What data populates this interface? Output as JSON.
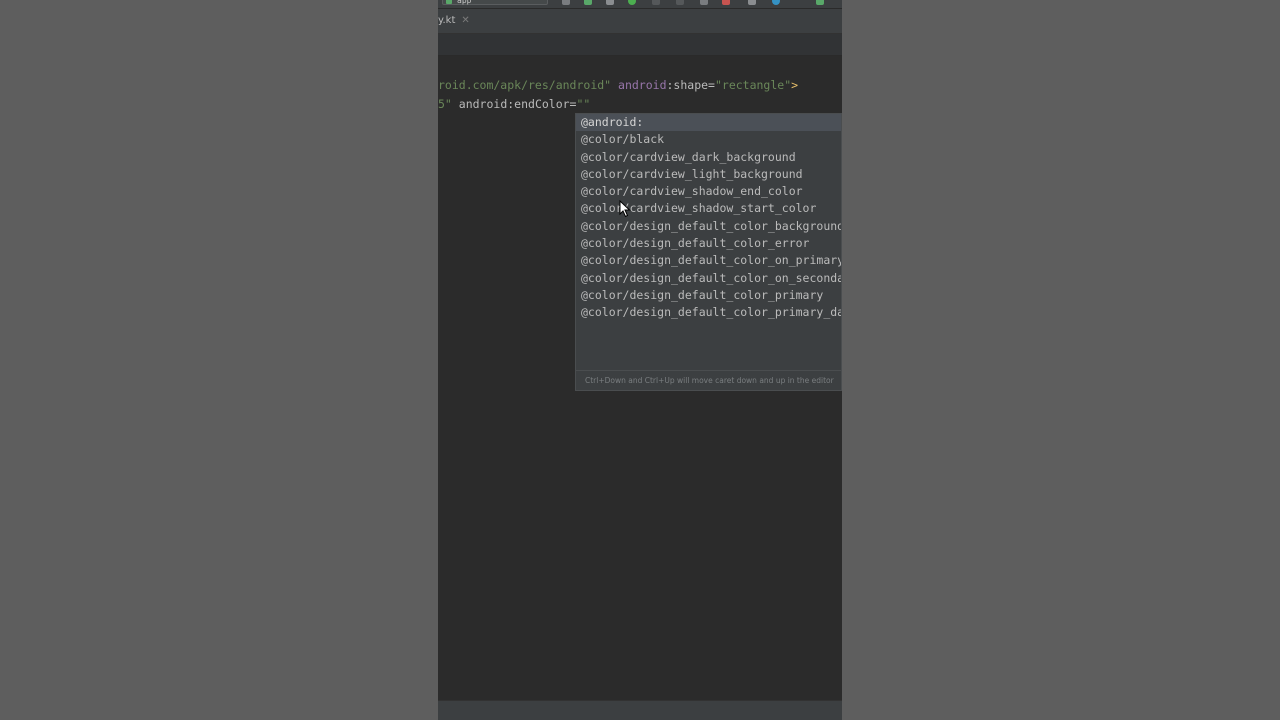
{
  "window": {
    "toolbar_field": "app"
  },
  "tabs": [
    {
      "label": "y.kt"
    }
  ],
  "editor": {
    "line1": {
      "p1": "roid.com/apk/res/android\"",
      "ns": "android",
      "attr": ":shape=",
      "val": "\"rectangle\"",
      "end": ">"
    },
    "line2": {
      "p1": "5\"",
      "attr": " android:endColor=",
      "val": "\"\""
    }
  },
  "autocomplete": {
    "items": [
      "@android:",
      "@color/black",
      "@color/cardview_dark_background",
      "@color/cardview_light_background",
      "@color/cardview_shadow_end_color",
      "@color/cardview_shadow_start_color",
      "@color/design_default_color_background",
      "@color/design_default_color_error",
      "@color/design_default_color_on_primary",
      "@color/design_default_color_on_secondary",
      "@color/design_default_color_primary",
      "@color/design_default_color_primary_dark"
    ],
    "hint": "Ctrl+Down and Ctrl+Up will move caret down and up in the editor"
  },
  "colors": {
    "editor_bg": "#2b2b2b",
    "popup_bg": "#3c3f41",
    "string_green": "#6a8759",
    "namespace_purple": "#9876aa"
  }
}
